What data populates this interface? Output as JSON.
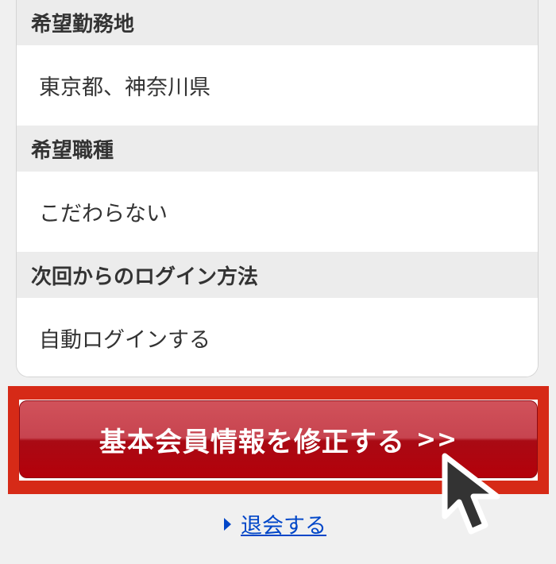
{
  "sections": [
    {
      "heading": "希望勤務地",
      "value": "東京都、神奈川県"
    },
    {
      "heading": "希望職種",
      "value": "こだわらない"
    },
    {
      "heading": "次回からのログイン方法",
      "value": "自動ログインする"
    }
  ],
  "main_button": {
    "label": "基本会員情報を修正する",
    "arrows": ">>"
  },
  "withdraw_link": {
    "label": "退会する"
  },
  "colors": {
    "button_red": "#b4000a",
    "highlight_red": "#d62a17",
    "link_blue": "#0046c8",
    "section_gray": "#ececec"
  },
  "icons": [
    "mouse-pointer-icon",
    "triangle-right-icon"
  ]
}
